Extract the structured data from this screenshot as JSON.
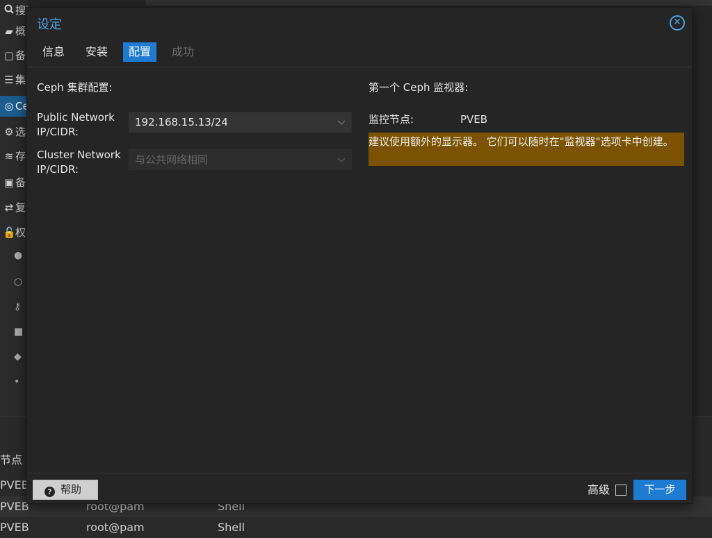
{
  "background": {
    "sidebar": [
      {
        "icon": "search-icon",
        "label": "搜索"
      },
      {
        "icon": "book-icon",
        "label": "概要"
      },
      {
        "icon": "note-icon",
        "label": "备注"
      },
      {
        "icon": "server-icon",
        "label": "集群"
      },
      {
        "icon": "ceph-icon",
        "label": "Ceph"
      },
      {
        "icon": "gear-icon",
        "label": "选项"
      },
      {
        "icon": "database-icon",
        "label": "存储"
      },
      {
        "icon": "save-icon",
        "label": "备份"
      },
      {
        "icon": "replication-icon",
        "label": "复制"
      },
      {
        "icon": "unlock-icon",
        "label": "权限"
      }
    ],
    "table_header": "节点",
    "rows": [
      {
        "node": "PVEB",
        "user": "",
        "type": ""
      },
      {
        "node": "PVEB",
        "user": "root@pam",
        "type": "Shell"
      },
      {
        "node": "PVEB",
        "user": "root@pam",
        "type": "Shell"
      }
    ]
  },
  "dialog": {
    "title": "设定",
    "tabs": [
      {
        "label": "信息",
        "state": "normal"
      },
      {
        "label": "安装",
        "state": "normal"
      },
      {
        "label": "配置",
        "state": "active"
      },
      {
        "label": "成功",
        "state": "disabled"
      }
    ],
    "left": {
      "section_title": "Ceph 集群配置:",
      "public_network": {
        "label_line1": "Public Network",
        "label_line2": "IP/CIDR:",
        "value": "192.168.15.13/24"
      },
      "cluster_network": {
        "label_line1": "Cluster Network",
        "label_line2": "IP/CIDR:",
        "placeholder": "与公共网络相同"
      }
    },
    "right": {
      "section_title": "第一个 Ceph 监视器:",
      "monitor_label": "监控节点:",
      "monitor_value": "PVEB",
      "warning": "建议使用额外的显示器。 它们可以随时在\"监视器\"选项卡中创建。"
    },
    "footer": {
      "help_label": "帮助",
      "advanced_label": "高级",
      "next_label": "下一步"
    }
  },
  "colors": {
    "accent": "#1f7bd1",
    "title": "#4da3e0",
    "warning_bg": "#7a5200"
  }
}
